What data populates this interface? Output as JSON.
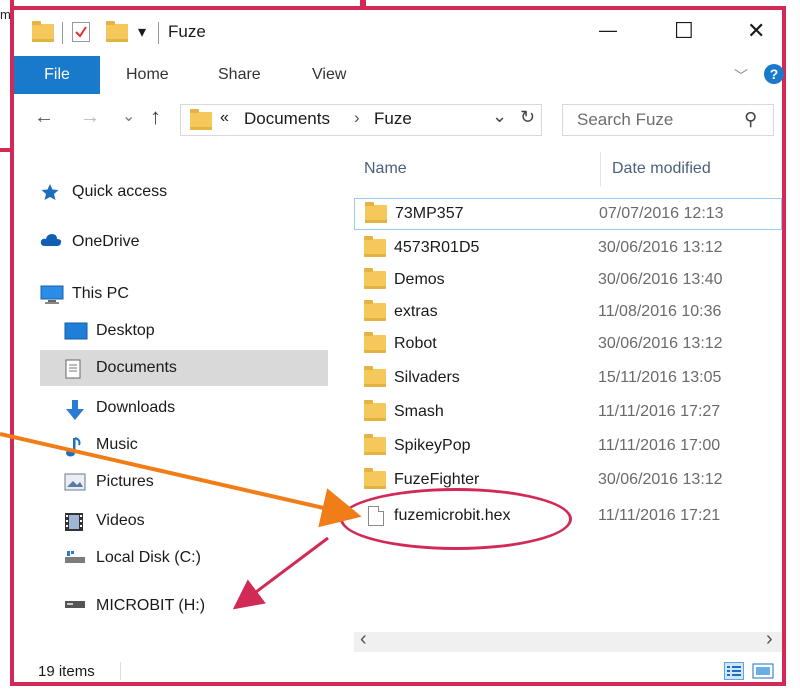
{
  "background_fragment": "m",
  "window": {
    "title": "Fuze",
    "qat_dropdown": "▾",
    "controls": {
      "minimize": "—",
      "maximize": "☐",
      "close": "✕"
    }
  },
  "ribbon": {
    "tabs": [
      {
        "label": "File"
      },
      {
        "label": "Home"
      },
      {
        "label": "Share"
      },
      {
        "label": "View"
      }
    ],
    "expand_chevron": "﹀",
    "help": "?"
  },
  "address": {
    "back": "←",
    "forward": "→",
    "recent": "⌄",
    "up": "↑",
    "overflow": "«",
    "segments": [
      "Documents",
      "Fuze"
    ],
    "separator": "›",
    "dropdown": "⌄",
    "refresh": "↻"
  },
  "search": {
    "placeholder": "Search Fuze",
    "icon": "⚲"
  },
  "nav": {
    "items": [
      {
        "label": "Quick access",
        "icon": "star-icon"
      },
      {
        "label": "OneDrive",
        "icon": "cloud-icon"
      },
      {
        "label": "This PC",
        "icon": "computer-icon"
      },
      {
        "label": "Desktop",
        "icon": "desktop-icon"
      },
      {
        "label": "Documents",
        "icon": "documents-icon",
        "selected": true
      },
      {
        "label": "Downloads",
        "icon": "download-arrow-icon"
      },
      {
        "label": "Music",
        "icon": "music-note-icon"
      },
      {
        "label": "Pictures",
        "icon": "pictures-icon"
      },
      {
        "label": "Videos",
        "icon": "film-icon"
      },
      {
        "label": "Local Disk (C:)",
        "icon": "drive-icon"
      },
      {
        "label": "MICROBIT (H:)",
        "icon": "usb-drive-icon"
      }
    ]
  },
  "columns": {
    "name": "Name",
    "date": "Date modified"
  },
  "files": [
    {
      "name": "73MP357",
      "date": "07/07/2016 12:13",
      "type": "folder"
    },
    {
      "name": "4573R01D5",
      "date": "30/06/2016 13:12",
      "type": "folder"
    },
    {
      "name": "Demos",
      "date": "30/06/2016 13:40",
      "type": "folder"
    },
    {
      "name": "extras",
      "date": "11/08/2016 10:36",
      "type": "folder"
    },
    {
      "name": "Robot",
      "date": "30/06/2016 13:12",
      "type": "folder"
    },
    {
      "name": "Silvaders",
      "date": "15/11/2016 13:05",
      "type": "folder"
    },
    {
      "name": "Smash",
      "date": "11/11/2016 17:27",
      "type": "folder"
    },
    {
      "name": "SpikeyPop",
      "date": "11/11/2016 17:00",
      "type": "folder"
    },
    {
      "name": "FuzeFighter",
      "date": "30/06/2016 13:12",
      "type": "folder"
    },
    {
      "name": "fuzemicrobit.hex",
      "date": "11/11/2016 17:21",
      "type": "file"
    }
  ],
  "scroll": {
    "left": "‹",
    "right": "›"
  },
  "status": {
    "items": "19 items"
  },
  "colors": {
    "annotation_pink": "#d22a57",
    "annotation_orange": "#f07d17",
    "file_tab_blue": "#1979ca"
  }
}
